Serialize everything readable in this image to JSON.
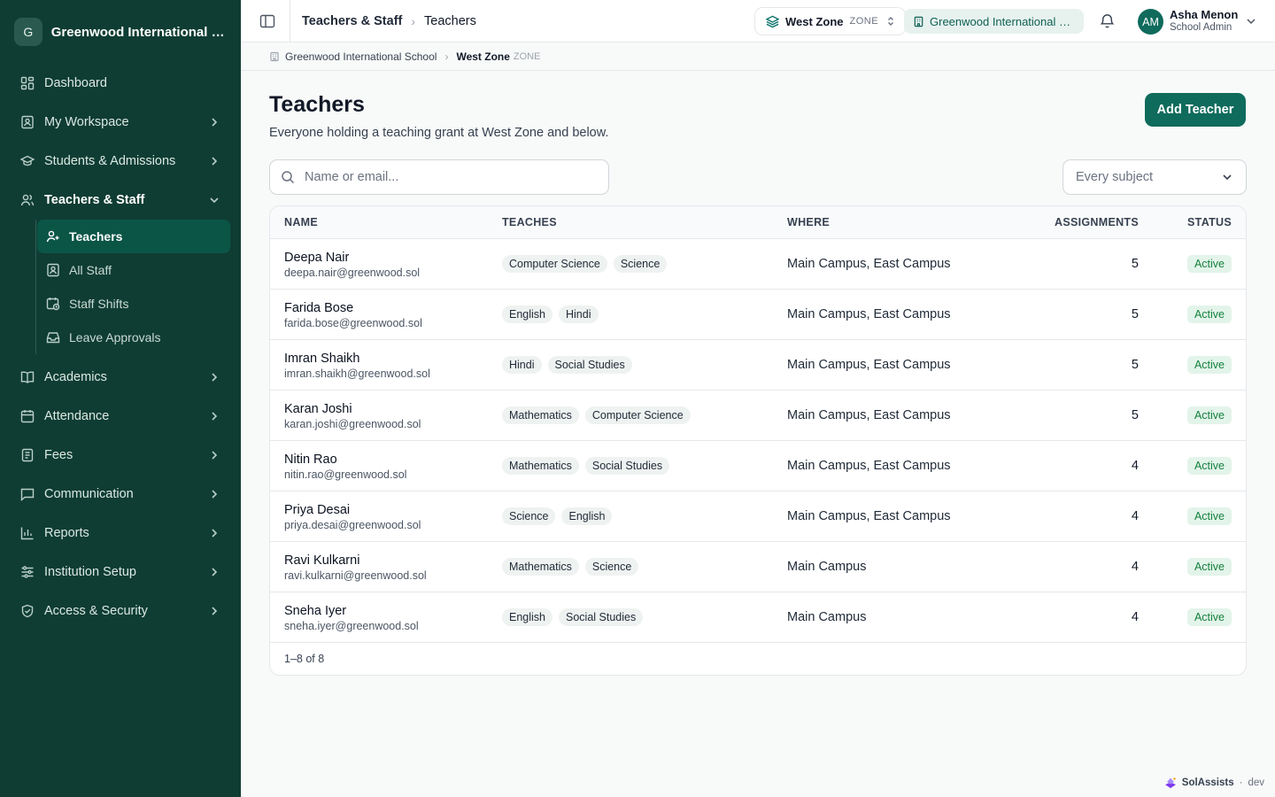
{
  "org": {
    "initial": "G",
    "name": "Greenwood International School"
  },
  "nav": {
    "dashboard": "Dashboard",
    "workspace": "My Workspace",
    "students": "Students & Admissions",
    "teachers_staff": "Teachers & Staff",
    "sub": {
      "teachers": "Teachers",
      "all_staff": "All Staff",
      "shifts": "Staff Shifts",
      "leave": "Leave Approvals"
    },
    "academics": "Academics",
    "attendance": "Attendance",
    "fees": "Fees",
    "communication": "Communication",
    "reports": "Reports",
    "institution": "Institution Setup",
    "access": "Access & Security"
  },
  "topbar": {
    "crumb1": "Teachers & Staff",
    "crumb2": "Teachers",
    "zone_name": "West Zone",
    "zone_tag": "ZONE",
    "school": "Greenwood International School",
    "user_initials": "AM",
    "user_name": "Asha Menon",
    "user_role": "School Admin"
  },
  "location": {
    "school": "Greenwood International School",
    "zone": "West Zone",
    "zone_tag": "ZONE"
  },
  "page": {
    "title": "Teachers",
    "subtitle": "Everyone holding a teaching grant at West Zone and below.",
    "add_button": "Add Teacher",
    "search_placeholder": "Name or email...",
    "subject_filter": "Every subject"
  },
  "table": {
    "headers": {
      "name": "NAME",
      "teaches": "TEACHES",
      "where": "WHERE",
      "assignments": "ASSIGNMENTS",
      "status": "STATUS"
    },
    "rows": [
      {
        "name": "Deepa Nair",
        "email": "deepa.nair@greenwood.sol",
        "subjects": [
          "Computer Science",
          "Science"
        ],
        "where": "Main Campus, East Campus",
        "assignments": "5",
        "status": "Active"
      },
      {
        "name": "Farida Bose",
        "email": "farida.bose@greenwood.sol",
        "subjects": [
          "English",
          "Hindi"
        ],
        "where": "Main Campus, East Campus",
        "assignments": "5",
        "status": "Active"
      },
      {
        "name": "Imran Shaikh",
        "email": "imran.shaikh@greenwood.sol",
        "subjects": [
          "Hindi",
          "Social Studies"
        ],
        "where": "Main Campus, East Campus",
        "assignments": "5",
        "status": "Active"
      },
      {
        "name": "Karan Joshi",
        "email": "karan.joshi@greenwood.sol",
        "subjects": [
          "Mathematics",
          "Computer Science"
        ],
        "where": "Main Campus, East Campus",
        "assignments": "5",
        "status": "Active"
      },
      {
        "name": "Nitin Rao",
        "email": "nitin.rao@greenwood.sol",
        "subjects": [
          "Mathematics",
          "Social Studies"
        ],
        "where": "Main Campus, East Campus",
        "assignments": "4",
        "status": "Active"
      },
      {
        "name": "Priya Desai",
        "email": "priya.desai@greenwood.sol",
        "subjects": [
          "Science",
          "English"
        ],
        "where": "Main Campus, East Campus",
        "assignments": "4",
        "status": "Active"
      },
      {
        "name": "Ravi Kulkarni",
        "email": "ravi.kulkarni@greenwood.sol",
        "subjects": [
          "Mathematics",
          "Science"
        ],
        "where": "Main Campus",
        "assignments": "4",
        "status": "Active"
      },
      {
        "name": "Sneha Iyer",
        "email": "sneha.iyer@greenwood.sol",
        "subjects": [
          "English",
          "Social Studies"
        ],
        "where": "Main Campus",
        "assignments": "4",
        "status": "Active"
      }
    ],
    "pagination": "1–8 of 8"
  },
  "footer": {
    "brand": "SolAssists",
    "sep": "·",
    "env": "dev"
  },
  "colors": {
    "sidebar": "#0f3d33",
    "accent": "#0f6b5c",
    "active_bg": "#0b5547",
    "status_green": "#15803d"
  },
  "icons": {
    "nav": [
      "dashboard-icon",
      "workspace-icon",
      "graduation-cap-icon",
      "users-icon",
      "teacher-icon",
      "id-card-icon",
      "calendar-clock-icon",
      "inbox-icon",
      "book-icon",
      "calendar-icon",
      "receipt-icon",
      "message-icon",
      "bar-chart-icon",
      "sliders-icon",
      "shield-icon"
    ]
  }
}
